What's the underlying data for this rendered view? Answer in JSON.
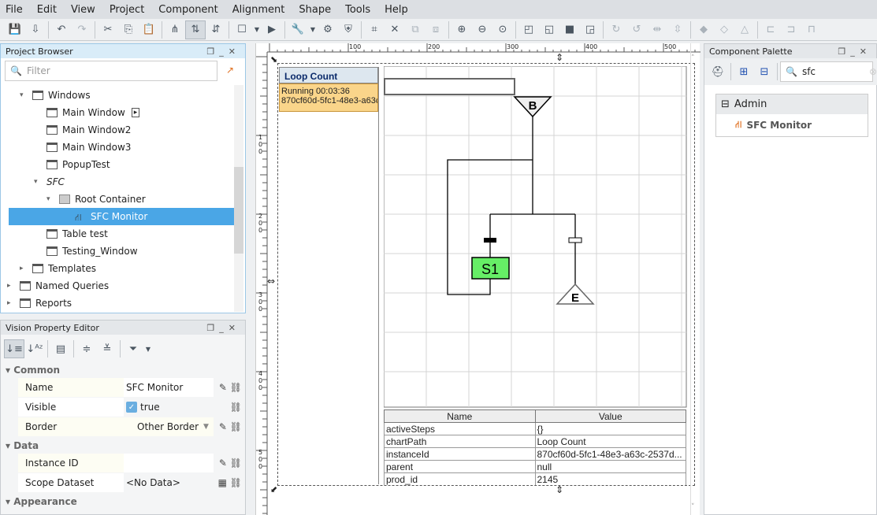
{
  "menu": [
    "File",
    "Edit",
    "View",
    "Project",
    "Component",
    "Alignment",
    "Shape",
    "Tools",
    "Help"
  ],
  "project_browser": {
    "title": "Project Browser",
    "filter_placeholder": "Filter",
    "items": [
      {
        "label": "Windows",
        "level": 1,
        "icon": "folder-window"
      },
      {
        "label": "Main Window",
        "level": 2,
        "icon": "window"
      },
      {
        "label": "Main Window2",
        "level": 2,
        "icon": "window"
      },
      {
        "label": "Main Window3",
        "level": 2,
        "icon": "window"
      },
      {
        "label": "PopupTest",
        "level": 2,
        "icon": "window"
      },
      {
        "label": "SFC",
        "level": 2,
        "icon": "none"
      },
      {
        "label": "Root Container",
        "level": 3,
        "icon": "container"
      },
      {
        "label": "SFC Monitor",
        "level": 4,
        "icon": "sfc",
        "selected": true
      },
      {
        "label": "Table test",
        "level": 2,
        "icon": "window"
      },
      {
        "label": "Testing_Window",
        "level": 2,
        "icon": "window"
      },
      {
        "label": "Templates",
        "level": 1,
        "icon": "templates"
      },
      {
        "label": "Named Queries",
        "level": 0,
        "icon": "queries"
      },
      {
        "label": "Reports",
        "level": 0,
        "icon": "reports"
      }
    ]
  },
  "property_editor": {
    "title": "Vision Property Editor",
    "sections": {
      "common": "Common",
      "data": "Data",
      "appearance": "Appearance"
    },
    "props": {
      "name": {
        "label": "Name",
        "value": "SFC Monitor"
      },
      "visible": {
        "label": "Visible",
        "value": "true"
      },
      "border": {
        "label": "Border",
        "value": "Other Border"
      },
      "instance_id": {
        "label": "Instance ID",
        "value": ""
      },
      "scope_dataset": {
        "label": "Scope Dataset",
        "value": "<No Data>"
      }
    }
  },
  "canvas": {
    "ruler_labels": [
      "100",
      "200",
      "300",
      "400",
      "500"
    ],
    "vruler_labels": [
      "100",
      "200",
      "300",
      "400",
      "500"
    ],
    "chart_list": {
      "title": "Loop Count",
      "status": "Running 00:03:36",
      "id": "870cf60d-5fc1-48e3-a63c"
    },
    "steps": {
      "begin": "B",
      "step": "S1",
      "end": "E"
    },
    "step_active_color": "#66ee66",
    "table": {
      "headers": [
        "Name",
        "Value"
      ],
      "rows": [
        [
          "activeSteps",
          "{}"
        ],
        [
          "chartPath",
          "Loop Count"
        ],
        [
          "instanceId",
          "870cf60d-5fc1-48e3-a63c-2537d..."
        ],
        [
          "parent",
          "null"
        ],
        [
          "prod_id",
          "2145"
        ]
      ]
    }
  },
  "palette": {
    "title": "Component Palette",
    "search": "sfc",
    "group": "Admin",
    "item": "SFC Monitor"
  }
}
